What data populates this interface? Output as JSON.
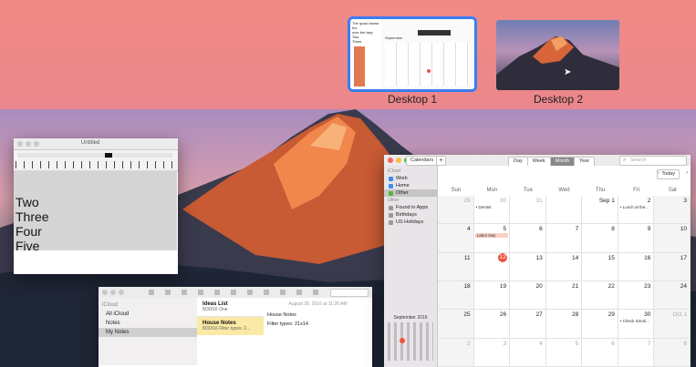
{
  "spaces": [
    {
      "label": "Desktop 1",
      "active": true
    },
    {
      "label": "Desktop 2",
      "active": false
    }
  ],
  "thumb1": {
    "lines": [
      "The quick brown fox",
      "over the lazy",
      "Two",
      "Three"
    ],
    "cal_month": "September"
  },
  "textedit": {
    "title": "Untitled",
    "lines": [
      "Two",
      "Three",
      "Four",
      "Five"
    ]
  },
  "calendar": {
    "sidebar_button": "Calendars",
    "add_button": "+",
    "views": [
      "Day",
      "Week",
      "Month",
      "Year"
    ],
    "active_view": "Month",
    "search_placeholder": "Search",
    "today_button": "Today",
    "sidebar": {
      "icloud_header": "iCloud",
      "icloud_items": [
        {
          "label": "Work",
          "color": "#3c8ef3"
        },
        {
          "label": "Home",
          "color": "#3c8ef3"
        },
        {
          "label": "Other",
          "color": "#59b33a",
          "selected": true
        }
      ],
      "other_header": "Other",
      "other_items": [
        {
          "label": "Found in Apps",
          "color": "#999999"
        },
        {
          "label": "Birthdays",
          "color": "#999999"
        },
        {
          "label": "US Holidays",
          "color": "#999999"
        }
      ],
      "mini_month": "September 2016"
    },
    "weekdays": [
      "Sun",
      "Mon",
      "Tue",
      "Wed",
      "Thu",
      "Fri",
      "Sat"
    ],
    "weeks": [
      [
        "29",
        "30",
        "31",
        "",
        "Sep 1",
        "2",
        "3"
      ],
      [
        "4",
        "5",
        "6",
        "7",
        "8",
        "9",
        "10"
      ],
      [
        "11",
        "12",
        "13",
        "14",
        "15",
        "16",
        "17"
      ],
      [
        "18",
        "19",
        "20",
        "21",
        "22",
        "23",
        "24"
      ],
      [
        "25",
        "26",
        "27",
        "28",
        "29",
        "30",
        "Oct 1"
      ],
      [
        "2",
        "3",
        "4",
        "5",
        "6",
        "7",
        "8"
      ]
    ],
    "events": {
      "dentist": "• Dentist",
      "lunch": "• Lunch at the...",
      "labor_day": "Labor Day",
      "check": "• Check Smok..."
    },
    "today": "12"
  },
  "notes": {
    "sidebar_header": "iCloud",
    "sidebar_items": [
      "All iCloud",
      "Notes",
      "My Notes"
    ],
    "list": [
      {
        "title": "Ideas List",
        "sub": "8/30/16  One"
      },
      {
        "title": "House Notes",
        "sub": "8/30/16  Filter types: 2..."
      }
    ],
    "date": "August 30, 2016 at 11:26 AM",
    "content_title": "House Notes",
    "content_line": "Filter types: 21x14"
  }
}
